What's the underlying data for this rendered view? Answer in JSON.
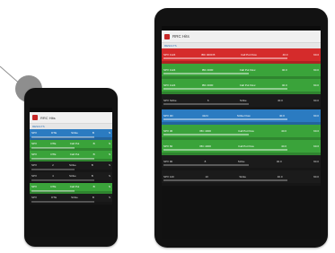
{
  "colors": {
    "red": "#d52b2b",
    "green": "#3aa33a",
    "blue": "#2b7bc1",
    "dark": "#1b1b1b"
  },
  "small_device": {
    "clock": "",
    "app_title": "RRC Hits",
    "section_label": "RESULTS",
    "rows": [
      {
        "color": "blue",
        "cells": [
          "SPX",
          "DTE",
          "Strike",
          "B",
          "S"
        ]
      },
      {
        "color": "green",
        "cells": [
          "SPX",
          "DTE",
          "Call Put",
          "B",
          "S"
        ]
      },
      {
        "color": "green",
        "cells": [
          "SPX",
          "DTE",
          "Call Put",
          "B",
          "S"
        ]
      },
      {
        "color": "dark",
        "cells": [
          "SPX",
          "2",
          "Strike",
          "B",
          "S"
        ]
      },
      {
        "color": "dark",
        "cells": [
          "SPX",
          "4",
          "Strike",
          "B",
          "S"
        ]
      },
      {
        "color": "green",
        "cells": [
          "SPX",
          "DTE",
          "Call Put",
          "B",
          "S"
        ]
      },
      {
        "color": "dark",
        "cells": [
          "SPX",
          "DTE",
          "Strike",
          "B",
          "S"
        ]
      }
    ]
  },
  "large_device": {
    "clock": "",
    "app_title": "RRC Hits",
    "section_label": "RESULTS",
    "rows": [
      {
        "color": "red",
        "cells": [
          "SPX 1124",
          "IBC 4000 B",
          "Call Put Flow",
          "40.0",
          "60.0"
        ]
      },
      {
        "color": "green",
        "cells": [
          "SPX 1124",
          "IBC 4000",
          "Call Put Flow",
          "40.0",
          "60.0"
        ]
      },
      {
        "color": "green",
        "cells": [
          "SPX 1124",
          "IBC 4000",
          "Call Put Flow",
          "40.0",
          "60.0"
        ]
      },
      {
        "color": "dark",
        "cells": [
          "SPX Strike",
          "6",
          "Strike",
          "40.0",
          "60.0"
        ]
      },
      {
        "color": "blue",
        "cells": [
          "SPX 4D",
          "4124",
          "Strike Flow",
          "40.0",
          "60.0"
        ]
      },
      {
        "color": "green",
        "cells": [
          "SPX 30",
          "IBC 4000",
          "Call Put Flow",
          "40.0",
          "60.0"
        ]
      },
      {
        "color": "green",
        "cells": [
          "SPX 60",
          "IBC 4000",
          "Call Put Flow",
          "40.0",
          "60.0"
        ]
      },
      {
        "color": "dark",
        "cells": [
          "SPX 90",
          "8",
          "Strike",
          "40.0",
          "60.0"
        ]
      },
      {
        "color": "dark",
        "cells": [
          "SPX 120",
          "10",
          "Strike",
          "40.0",
          "60.0"
        ]
      }
    ]
  }
}
